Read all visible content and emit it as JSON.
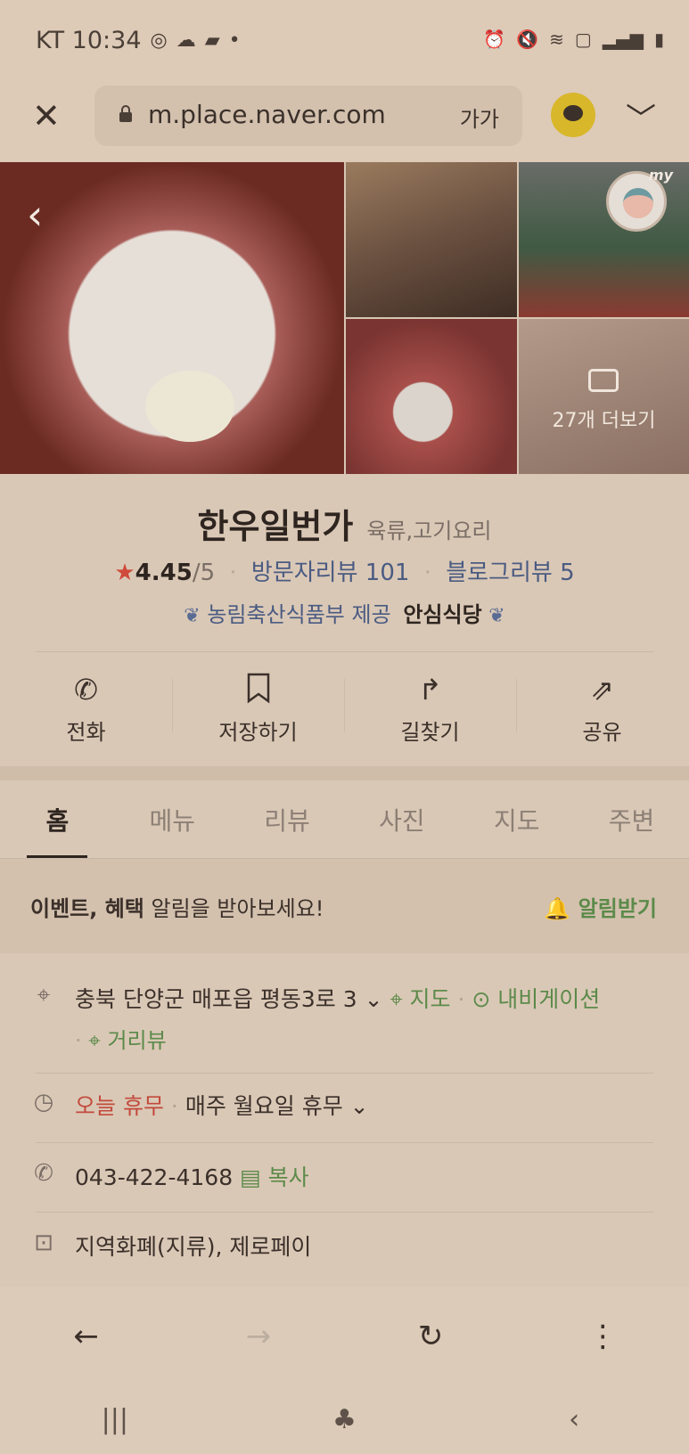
{
  "status_bar": {
    "carrier_time": "KT 10:34",
    "dot": "•"
  },
  "browser": {
    "url": "m.place.naver.com",
    "text_size_label": "가가"
  },
  "gallery": {
    "more_photos": "27개 더보기",
    "badge_text": "my"
  },
  "place": {
    "name": "한우일번가",
    "category": "육류,고기요리",
    "rating": "4.45",
    "rating_max": "/5",
    "visitor_reviews": "방문자리뷰 101",
    "blog_reviews": "블로그리뷰 5",
    "cert_org": "농림축산식품부 제공",
    "cert_badge": "안심식당"
  },
  "actions": [
    {
      "label": "전화",
      "icon": "phone-icon"
    },
    {
      "label": "저장하기",
      "icon": "bookmark-icon"
    },
    {
      "label": "길찾기",
      "icon": "directions-icon"
    },
    {
      "label": "공유",
      "icon": "share-icon"
    }
  ],
  "tabs": [
    "홈",
    "메뉴",
    "리뷰",
    "사진",
    "지도",
    "주변"
  ],
  "notice": {
    "bold1": "이벤트, 혜택",
    "rest": " 알림을 받아보세요!",
    "button": "알림받기"
  },
  "info": {
    "address": "충북 단양군 매포읍 평동3로 3",
    "map_link": "지도",
    "navigation_link": "내비게이션",
    "street_view_link": "거리뷰",
    "hours_status": "오늘 휴무",
    "hours_detail": "매주 월요일 휴무",
    "phone": "043-422-4168",
    "copy_label": "복사",
    "payment": "지역화폐(지류), 제로페이"
  },
  "colors": {
    "overlay_tint": "#d7c6b3",
    "accent_green": "#5c8a4a",
    "closed_red": "#c24a3c",
    "star": "#cf4a3c",
    "link_blue": "#4a5b82"
  }
}
